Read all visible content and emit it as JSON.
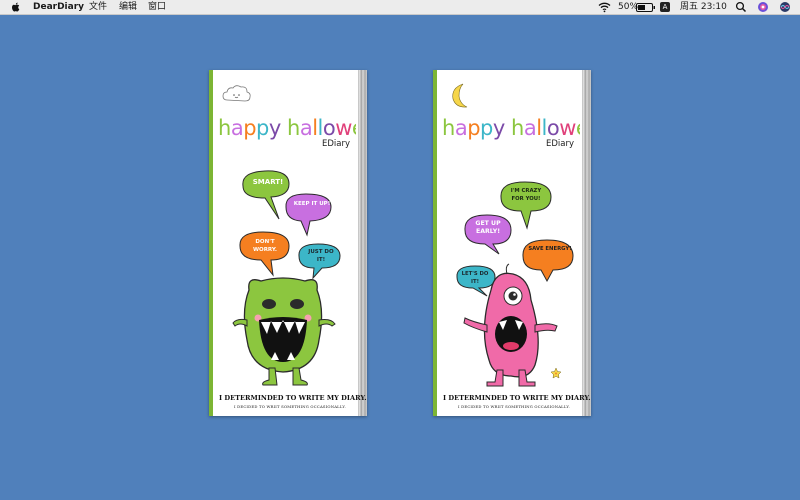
{
  "menubar": {
    "app_name": "DearDiary",
    "menus": [
      "文件",
      "编辑",
      "窗口"
    ],
    "battery_percent": "50%",
    "input_source": "A",
    "clock": "周五 23:10",
    "icons": [
      "apple-icon",
      "wifi-icon",
      "battery-icon",
      "input-source-icon",
      "search-icon",
      "notification-center-icon",
      "siri-icon"
    ]
  },
  "diaries": [
    {
      "title": "happy halloween",
      "brand": "EDiary",
      "bubbles": [
        "SMART!",
        "KEEP IT UP!",
        "DON'T WORRY.",
        "JUST DO IT!"
      ],
      "footer_line1": "I DETERMINDED TO WRITE MY DIARY.",
      "footer_line2": "I DECIDED TO WRIIT SOMETHING OCCASIONALLY.",
      "decoration": "cloud-icon",
      "monster_color": "#8cc63f"
    },
    {
      "title": "happy halloween",
      "brand": "EDiary",
      "bubbles": [
        "I'M CRAZY FOR YOU!",
        "GET UP EARLY!",
        "SAVE ENERGY!",
        "LET'S DO IT!"
      ],
      "footer_line1": "I DETERMINDED TO WRITE MY DIARY.",
      "footer_line2": "I DECIDED TO WRIIT SOMETHING OCCASIONALLY.",
      "decoration": "moon-icon",
      "monster_color": "#f06aa8"
    }
  ],
  "colors": {
    "desktop": "#5080bb",
    "spine": "#7cb534",
    "bubble_green": "#8cc63f",
    "bubble_purple": "#c86fe0",
    "bubble_orange": "#f57f20",
    "bubble_teal": "#3cb6c8"
  }
}
